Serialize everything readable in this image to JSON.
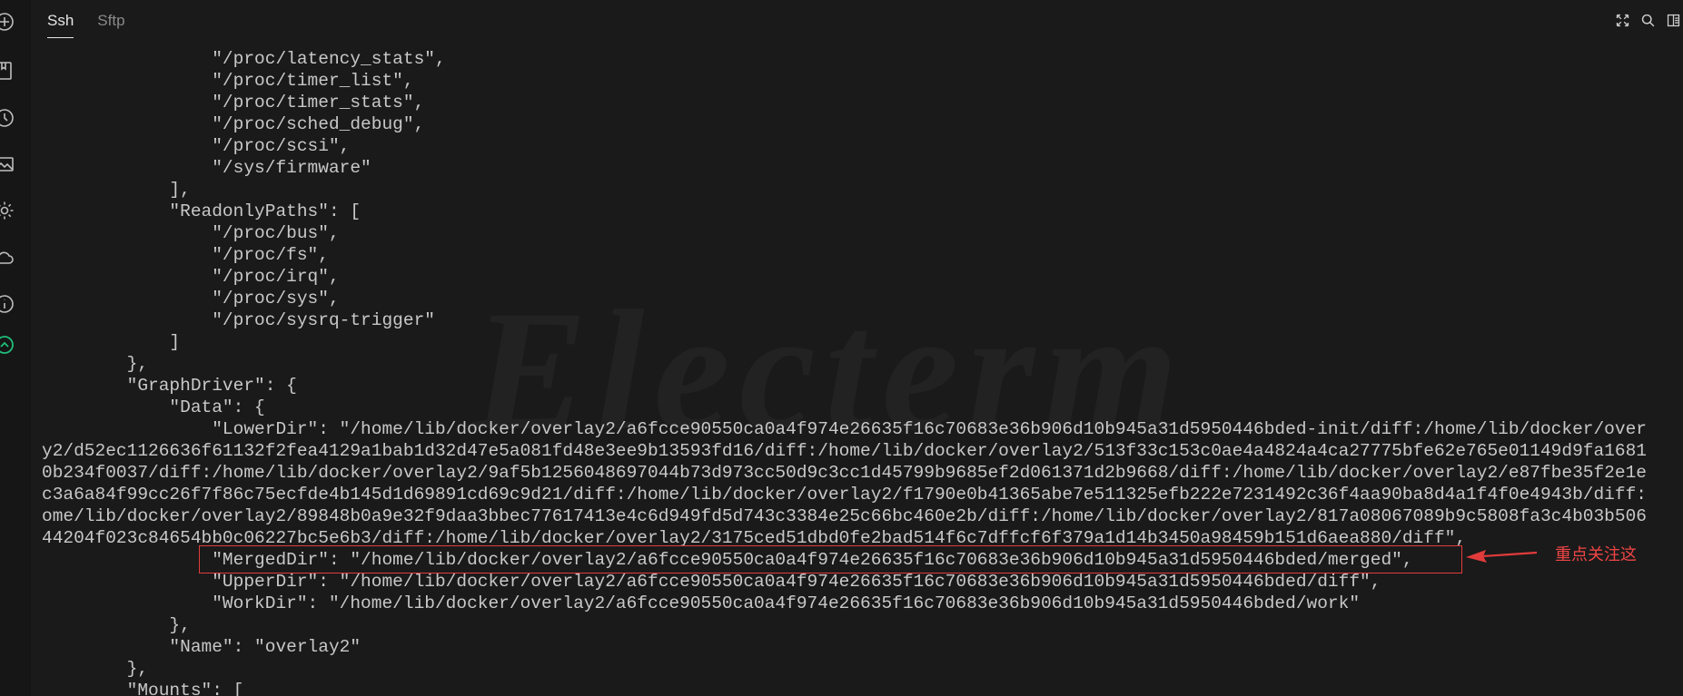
{
  "tabs": [
    {
      "label": "Ssh",
      "active": true
    },
    {
      "label": "Sftp",
      "active": false
    }
  ],
  "sidebar_icons": [
    "add-icon",
    "bookmark-icon",
    "history-icon",
    "image-icon",
    "settings-icon",
    "cloud-icon",
    "info-icon",
    "connection-status-icon"
  ],
  "toolbar_icons": [
    "fullscreen-icon",
    "search-icon",
    "split-icon"
  ],
  "watermark": "Electerm",
  "terminal_lines": [
    "                \"/proc/latency_stats\",",
    "                \"/proc/timer_list\",",
    "                \"/proc/timer_stats\",",
    "                \"/proc/sched_debug\",",
    "                \"/proc/scsi\",",
    "                \"/sys/firmware\"",
    "            ],",
    "            \"ReadonlyPaths\": [",
    "                \"/proc/bus\",",
    "                \"/proc/fs\",",
    "                \"/proc/irq\",",
    "                \"/proc/sys\",",
    "                \"/proc/sysrq-trigger\"",
    "            ]",
    "        },",
    "        \"GraphDriver\": {",
    "            \"Data\": {",
    "                \"LowerDir\": \"/home/lib/docker/overlay2/a6fcce90550ca0a4f974e26635f16c70683e36b906d10b945a31d5950446bded-init/diff:/home/lib/docker/over",
    "y2/d52ec1126636f61132f2fea4129a1bab1d32d47e5a081fd48e3ee9b13593fd16/diff:/home/lib/docker/overlay2/513f33c153c0ae4a4824a4ca27775bfe62e765e01149d9fa1681",
    "0b234f0037/diff:/home/lib/docker/overlay2/9af5b1256048697044b73d973cc50d9c3cc1d45799b9685ef2d061371d2b9668/diff:/home/lib/docker/overlay2/e87fbe35f2e1e",
    "c3a6a84f99cc26f7f86c75ecfde4b145d1d69891cd69c9d21/diff:/home/lib/docker/overlay2/f1790e0b41365abe7e511325efb222e7231492c36f4aa90ba8d4a1f4f0e4943b/diff:",
    "ome/lib/docker/overlay2/89848b0a9e32f9daa3bbec77617413e4c6d949fd5d743c3384e25c66bc460e2b/diff:/home/lib/docker/overlay2/817a08067089b9c5808fa3c4b03b506",
    "44204f023c84654bb0c06227bc5e6b3/diff:/home/lib/docker/overlay2/3175ced51dbd0fe2bad514f6c7dffcf6f379a1d14b3450a98459b151d6aea880/diff\",",
    "                \"MergedDir\": \"/home/lib/docker/overlay2/a6fcce90550ca0a4f974e26635f16c70683e36b906d10b945a31d5950446bded/merged\",",
    "                \"UpperDir\": \"/home/lib/docker/overlay2/a6fcce90550ca0a4f974e26635f16c70683e36b906d10b945a31d5950446bded/diff\",",
    "                \"WorkDir\": \"/home/lib/docker/overlay2/a6fcce90550ca0a4f974e26635f16c70683e36b906d10b945a31d5950446bded/work\"",
    "            },",
    "            \"Name\": \"overlay2\"",
    "        },",
    "        \"Mounts\": ["
  ],
  "annotation": {
    "text": "重点关注这",
    "color": "#f04545"
  },
  "colors": {
    "background": "#1a1a1a",
    "text": "#c8c8c8",
    "accent_green": "#1fbf7a",
    "annotation_red": "#e23b3b"
  }
}
